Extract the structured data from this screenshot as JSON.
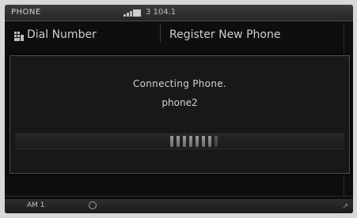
{
  "status_bar": {
    "title": "PHONE",
    "station": "3 104.1",
    "signal_icon": "signal-bars-icon"
  },
  "menu": {
    "dial_number": "Dial Number",
    "register_new_phone": "Register New Phone",
    "dial_icon": "keypad-icon"
  },
  "popup": {
    "line1": "Connecting Phone.",
    "line2": "phone2",
    "progress_segments_lit": 7,
    "progress_segments_total": 8
  },
  "bottom_bar": {
    "label": "AM 1",
    "icon": "clock-icon",
    "corner_icon": "resize-corner-icon"
  },
  "colors": {
    "background": "#0e0e0e",
    "text": "#d4d4d4",
    "popup": "#181818"
  }
}
